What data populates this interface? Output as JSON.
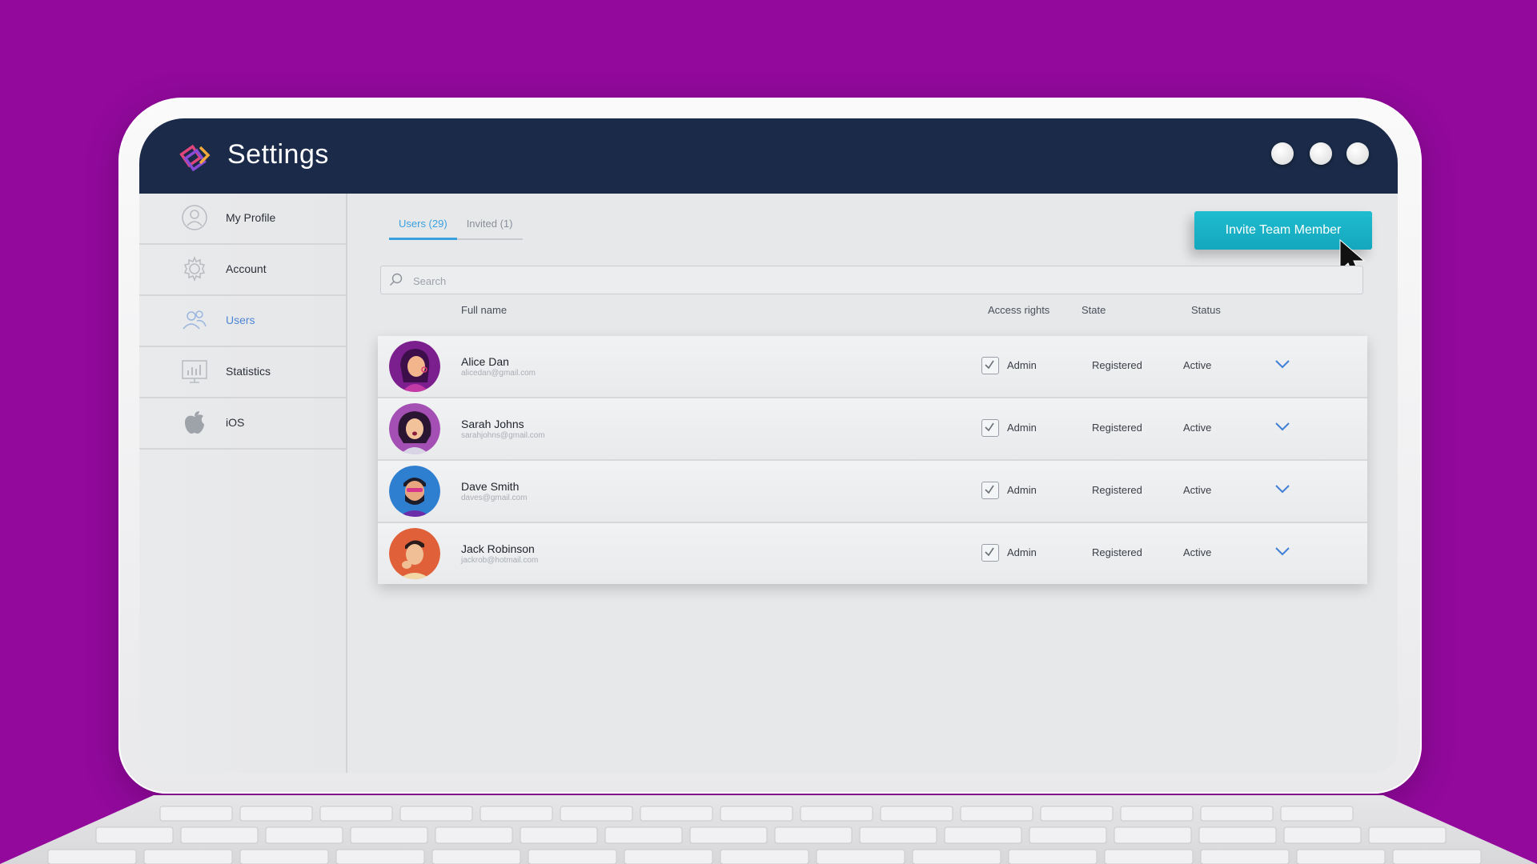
{
  "app": {
    "title": "Settings"
  },
  "sidebar": {
    "items": [
      {
        "label": "My Profile",
        "icon": "user-icon"
      },
      {
        "label": "Account",
        "icon": "gear-icon"
      },
      {
        "label": "Users",
        "icon": "users-icon",
        "active": true
      },
      {
        "label": "Statistics",
        "icon": "bar-chart-icon"
      },
      {
        "label": "iOS",
        "icon": "apple-icon"
      }
    ]
  },
  "tabs": [
    {
      "label": "Users (29)",
      "active": true
    },
    {
      "label": "Invited (1)",
      "active": false
    }
  ],
  "invite_button": {
    "label": "Invite Team Member",
    "color": "#1cb4c9"
  },
  "search": {
    "placeholder": "Search",
    "value": ""
  },
  "table": {
    "columns": [
      "Full name",
      "Access rights",
      "State",
      "Status"
    ],
    "rows": [
      {
        "name": "Alice Dan",
        "email": "alicedan@gmail.com",
        "access": "Admin",
        "access_checked": true,
        "state": "Registered",
        "status": "Active"
      },
      {
        "name": "Sarah Johns",
        "email": "sarahjohns@gmail.com",
        "access": "Admin",
        "access_checked": true,
        "state": "Registered",
        "status": "Active"
      },
      {
        "name": "Dave Smith",
        "email": "daves@gmail.com",
        "access": "Admin",
        "access_checked": true,
        "state": "Registered",
        "status": "Active"
      },
      {
        "name": "Jack Robinson",
        "email": "jackrob@hotmail.com",
        "access": "Admin",
        "access_checked": true,
        "state": "Registered",
        "status": "Active"
      }
    ]
  },
  "colors": {
    "background": "#92099c",
    "titlebar": "#1a2a48",
    "accent": "#3aa0e0",
    "active_sidebar": "#4f86d6"
  }
}
